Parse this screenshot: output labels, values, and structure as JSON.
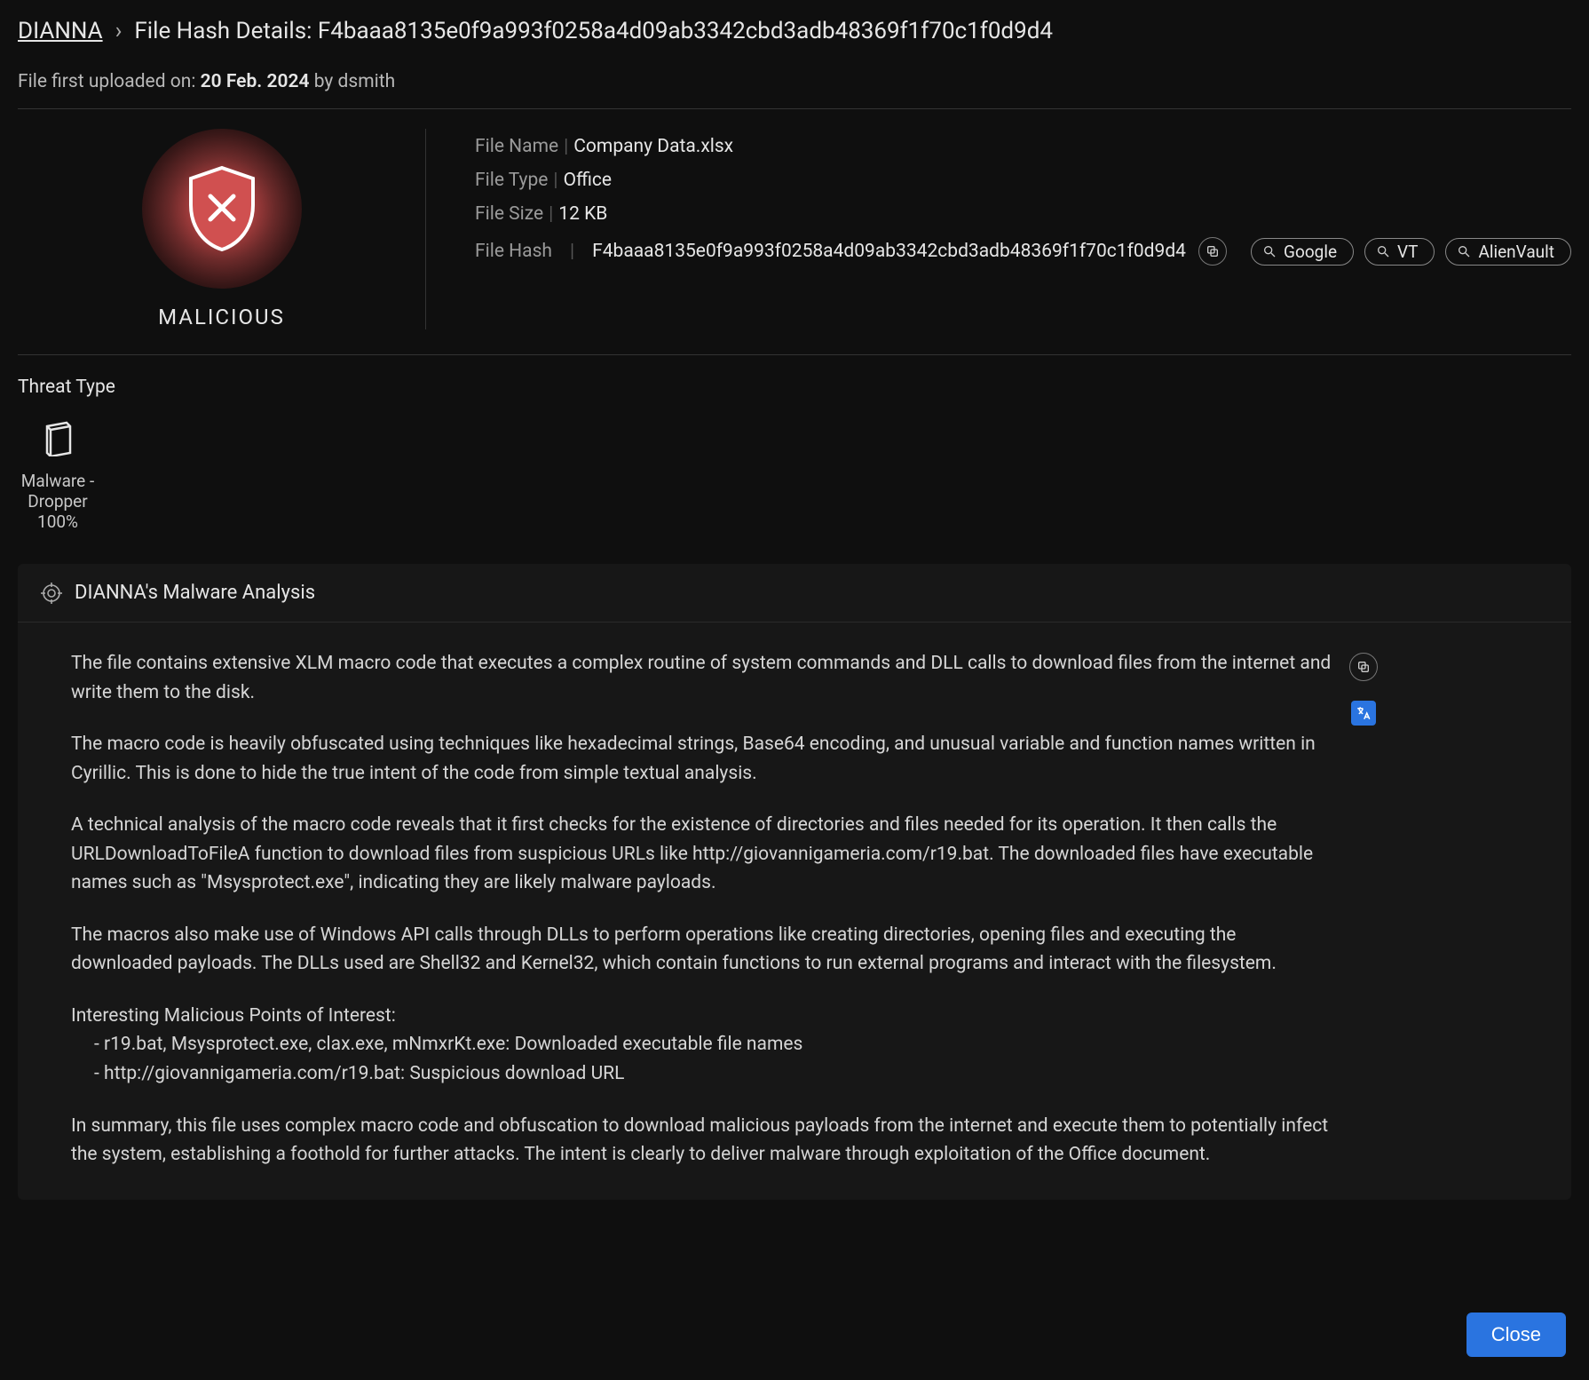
{
  "breadcrumb": {
    "root": "DIANNA",
    "sep": "›",
    "title_prefix": "File Hash Details:",
    "hash": "F4baaa8135e0f9a993f0258a4d09ab3342cbd3adb48369f1f70c1f0d9d4"
  },
  "upload": {
    "prefix": "File first uploaded on:",
    "date": "20 Feb. 2024",
    "by_word": "by",
    "user": "dsmith"
  },
  "verdict": "MALICIOUS",
  "meta": {
    "file_name_label": "File Name",
    "file_name": "Company Data.xlsx",
    "file_type_label": "File Type",
    "file_type": "Office",
    "file_size_label": "File Size",
    "file_size": "12 KB",
    "file_hash_label": "File Hash",
    "file_hash": "F4baaa8135e0f9a993f0258a4d09ab3342cbd3adb48369f1f70c1f0d9d4"
  },
  "search_links": {
    "google": "Google",
    "vt": "VT",
    "alienvault": "AlienVault"
  },
  "threat": {
    "section_title": "Threat Type",
    "name": "Malware - Dropper",
    "confidence": "100%"
  },
  "analysis": {
    "header": "DIANNA's Malware Analysis",
    "p1": "The file contains extensive XLM macro code that executes a complex routine of system commands and DLL calls to download files from the internet and write them to the disk.",
    "p2": "The macro code is heavily obfuscated using techniques like hexadecimal strings, Base64 encoding, and unusual variable and function names written in Cyrillic. This is done to hide the true intent of the code from simple textual analysis.",
    "p3": "A technical analysis of the macro code reveals that it first checks for the existence of directories and files needed for its operation. It then calls the URLDownloadToFileA function to download files from suspicious URLs like http://giovannigameria.com/r19.bat. The downloaded files have executable names such as \"Msysprotect.exe\", indicating they are likely malware payloads.",
    "p4": "The macros also make use of Windows API calls through DLLs to perform operations like creating directories, opening files and executing the downloaded payloads. The DLLs used are Shell32 and Kernel32, which contain functions to run external programs and interact with the filesystem.",
    "poi_title": "Interesting Malicious Points of Interest:",
    "poi_1": "- r19.bat, Msysprotect.exe, clax.exe, mNmxrKt.exe: Downloaded executable file names",
    "poi_2": "- http://giovannigameria.com/r19.bat: Suspicious download URL",
    "p5": "In summary, this file uses complex macro code and obfuscation to download malicious payloads from the internet and execute them to potentially infect the system, establishing a foothold for further attacks. The intent is clearly to deliver malware through exploitation of the Office document."
  },
  "footer": {
    "close": "Close"
  }
}
